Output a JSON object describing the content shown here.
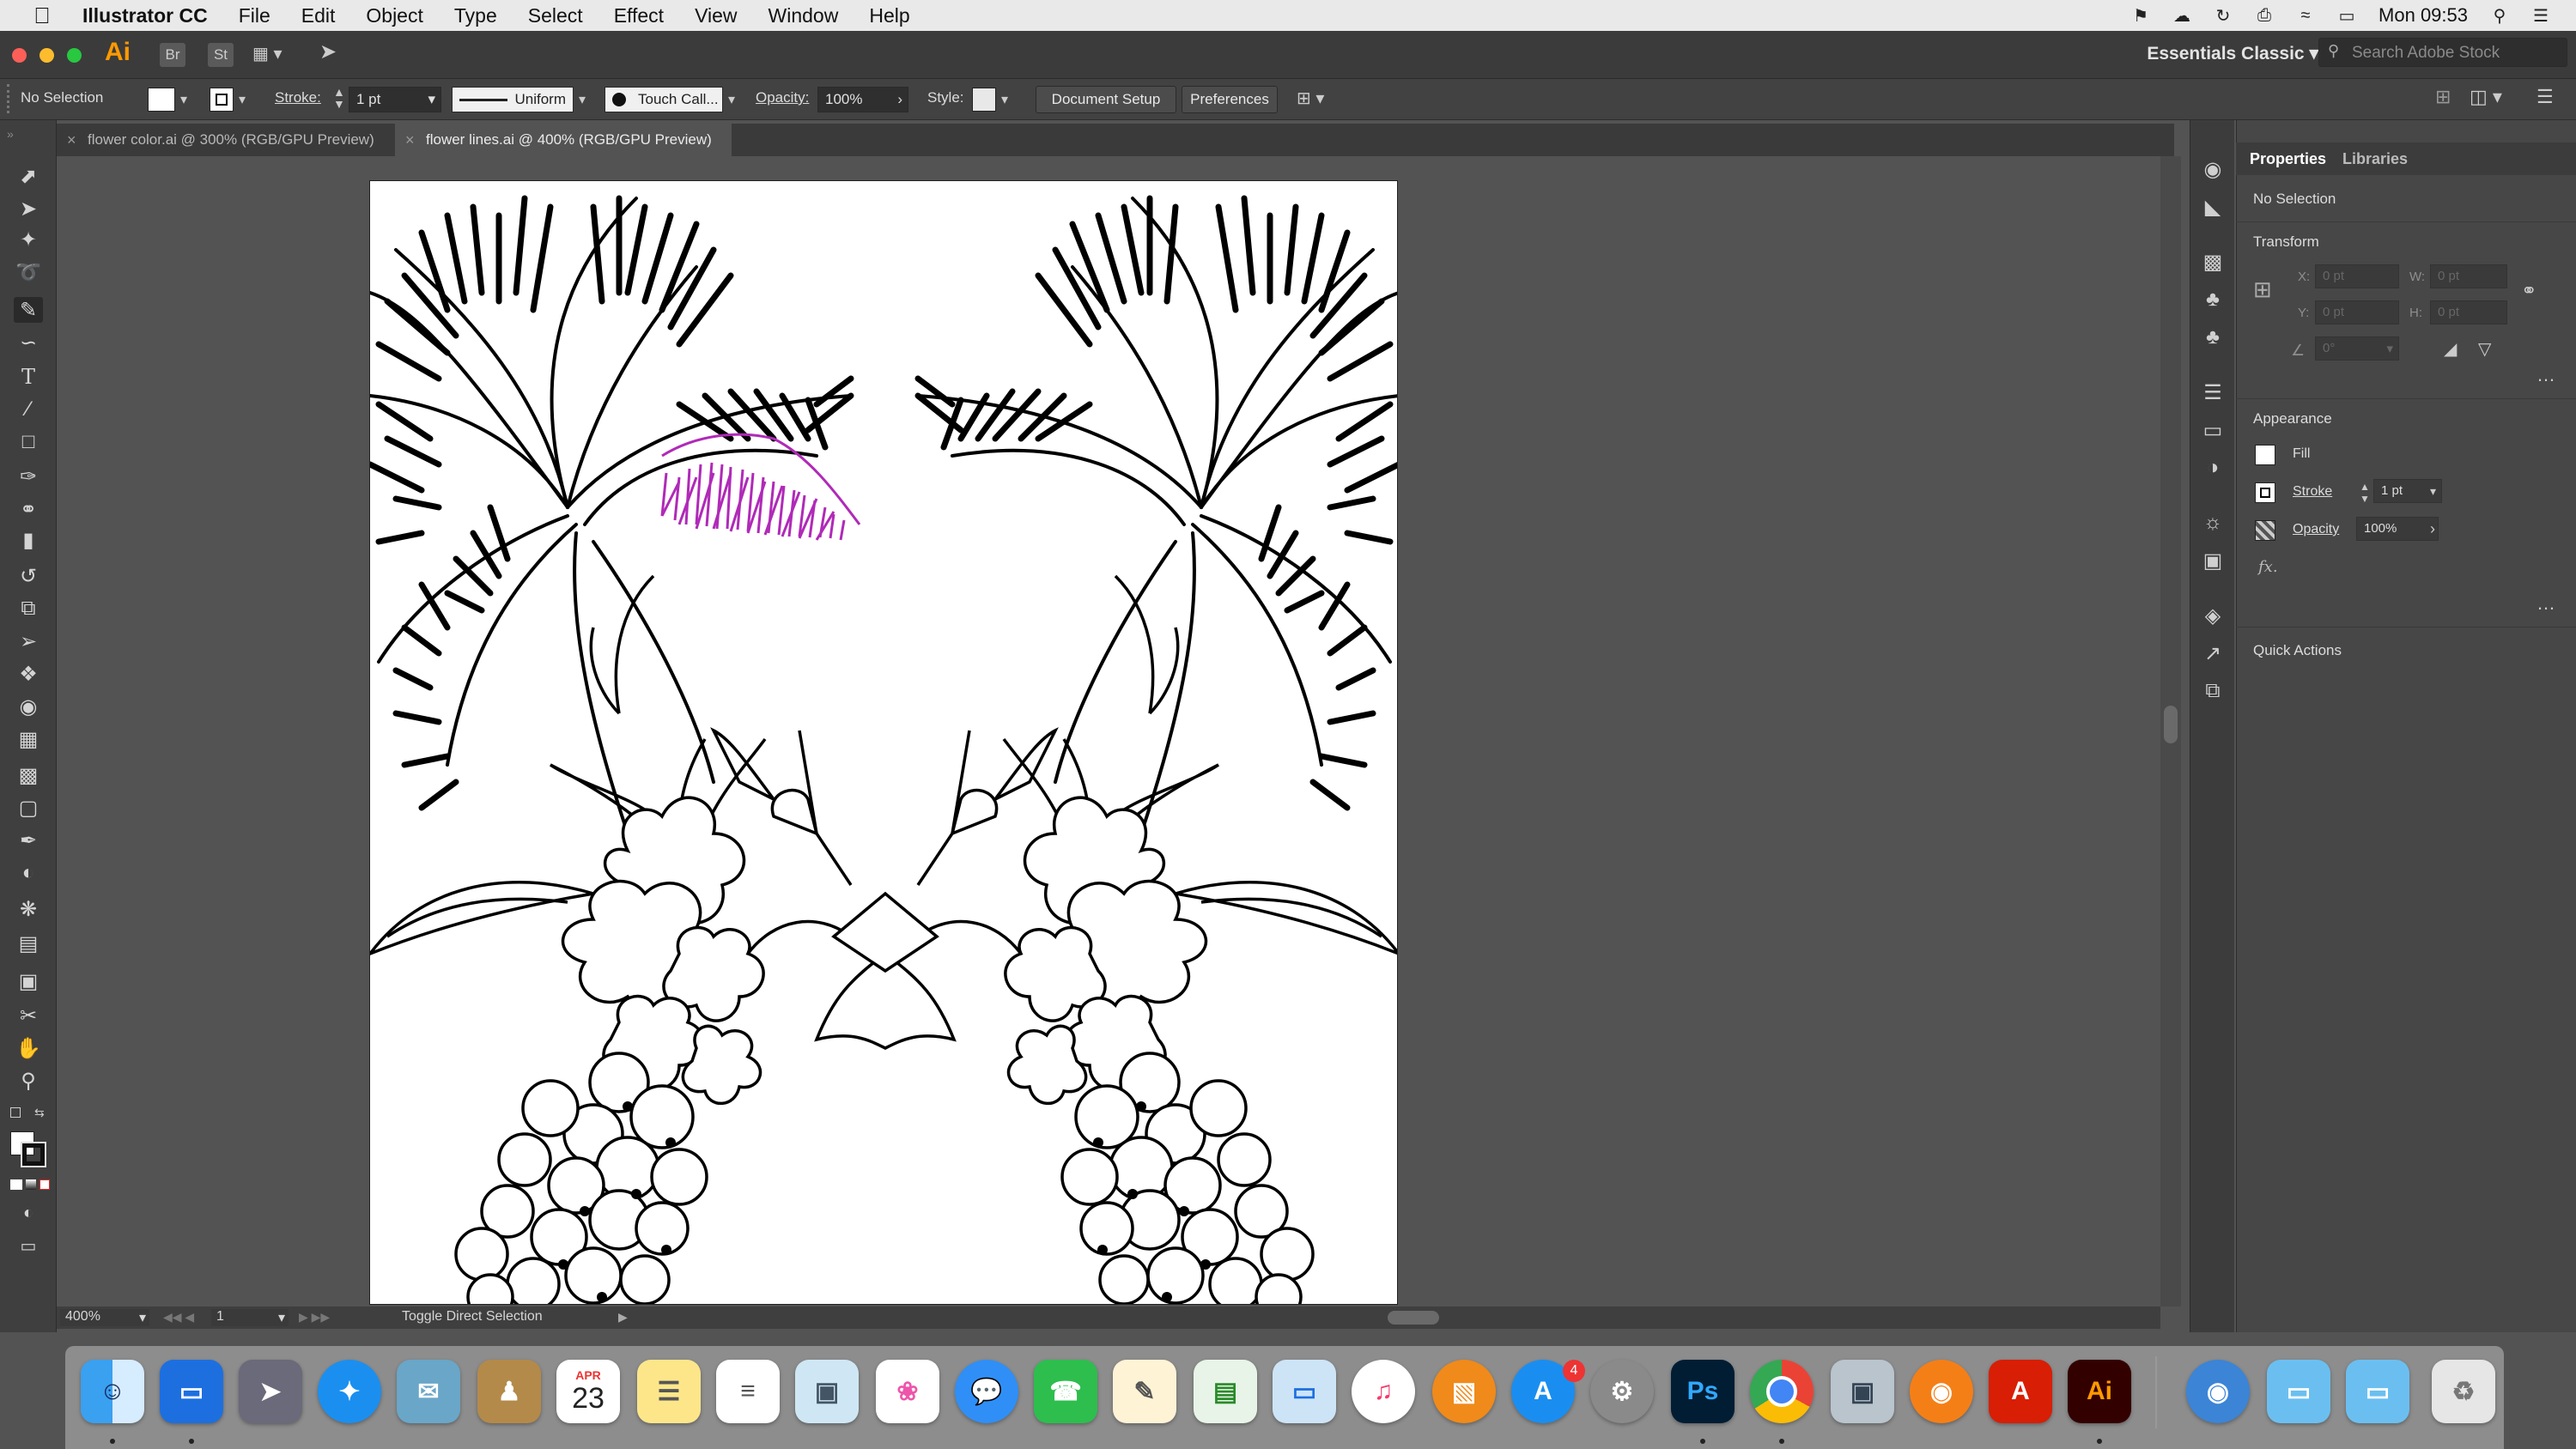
{
  "menubar": {
    "app_name": "Illustrator CC",
    "items": [
      "File",
      "Edit",
      "Object",
      "Type",
      "Select",
      "Effect",
      "View",
      "Window",
      "Help"
    ],
    "clock": "Mon 09:53"
  },
  "appbar": {
    "logo": "Ai",
    "bridge": "Br",
    "stock": "St",
    "workspace": "Essentials Classic",
    "search_placeholder": "Search Adobe Stock"
  },
  "control_bar": {
    "selection": "No Selection",
    "stroke_label": "Stroke:",
    "stroke_value": "1 pt",
    "profile": "Uniform",
    "brush": "Touch Call...",
    "opacity_label": "Opacity:",
    "opacity_value": "100%",
    "style_label": "Style:",
    "document_setup": "Document Setup",
    "preferences": "Preferences"
  },
  "tabs": [
    {
      "label": "flower color.ai @ 300% (RGB/GPU Preview)",
      "active": false
    },
    {
      "label": "flower lines.ai @ 400% (RGB/GPU Preview)",
      "active": true
    }
  ],
  "status_bar": {
    "zoom": "400%",
    "artboard": "1",
    "tool_hint": "Toggle Direct Selection"
  },
  "properties": {
    "tab_properties": "Properties",
    "tab_libraries": "Libraries",
    "selection": "No Selection",
    "transform_title": "Transform",
    "x_label": "X:",
    "y_label": "Y:",
    "w_label": "W:",
    "h_label": "H:",
    "x_value": "0 pt",
    "y_value": "0 pt",
    "w_value": "0 pt",
    "h_value": "0 pt",
    "angle_value": "0°",
    "appearance_title": "Appearance",
    "fill_label": "Fill",
    "stroke_label": "Stroke",
    "stroke_value": "1 pt",
    "opacity_label": "Opacity",
    "opacity_value": "100%",
    "fx_label": "fx.",
    "quick_actions": "Quick Actions"
  },
  "dock": {
    "calendar_month": "APR",
    "calendar_day": "23",
    "appstore_badge": "4",
    "ps_label": "Ps",
    "ai_label": "Ai"
  },
  "colors": {
    "ui_bg": "#535353",
    "panel_bg": "#474747",
    "highlight_stroke": "#b02ab8",
    "ai_orange": "#ff9a00"
  }
}
